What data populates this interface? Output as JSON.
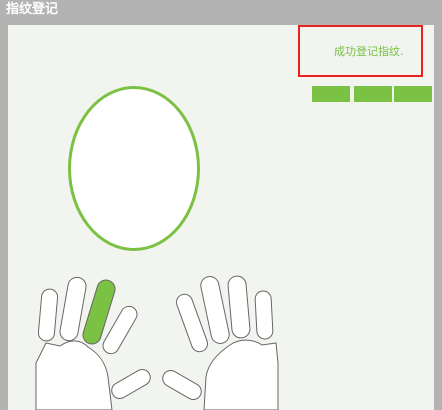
{
  "window": {
    "title": "指纹登记"
  },
  "status": {
    "message": "成功登记指纹."
  },
  "progress": {
    "segments_total": 3,
    "segments_filled": 3,
    "color": "#7bc143"
  },
  "colors": {
    "accent": "#7bc143",
    "alert_border": "#e8221f",
    "panel_bg": "#f2f4ef",
    "titlebar_bg": "#b3b3b3"
  },
  "hands": {
    "selected_finger": "left-index",
    "icons": [
      "left-hand-icon",
      "right-hand-icon",
      "fingerprint-preview"
    ]
  }
}
